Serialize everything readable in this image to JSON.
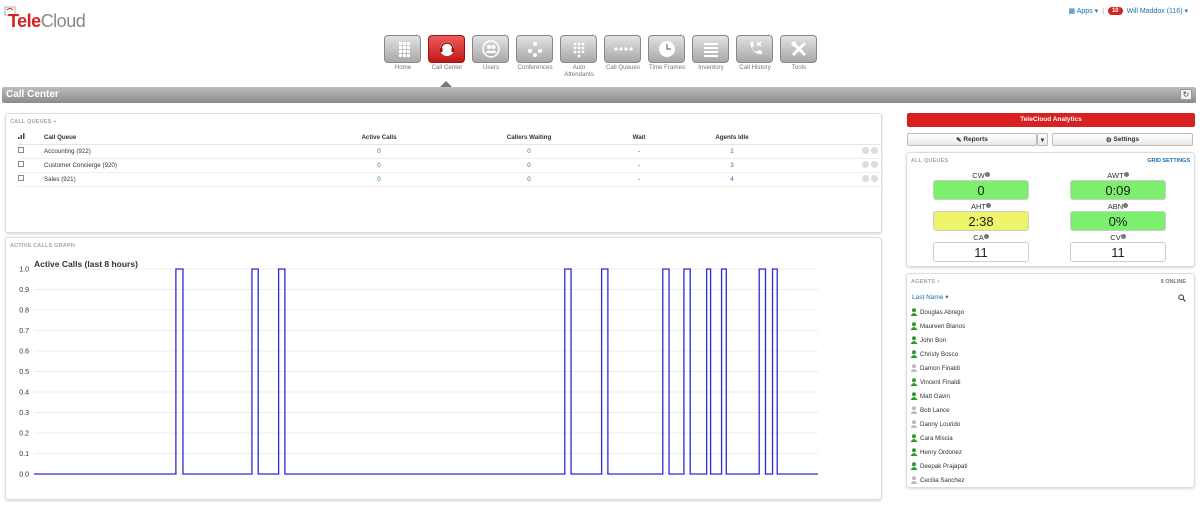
{
  "logo": "TeleCloud",
  "header": {
    "apps_label": "Apps",
    "badge": "10",
    "user_label": "Will Maddox (116)"
  },
  "nav": [
    {
      "label": "Home",
      "icon": "keypad-icon"
    },
    {
      "label": "Call Center",
      "icon": "headset-icon",
      "active": true
    },
    {
      "label": "Users",
      "icon": "users-icon"
    },
    {
      "label": "Conferences",
      "icon": "conference-icon"
    },
    {
      "label": "Auto Attendants",
      "icon": "dialpad-icon"
    },
    {
      "label": "Call Queues",
      "icon": "queue-icon"
    },
    {
      "label": "Time Frames",
      "icon": "clock-icon"
    },
    {
      "label": "Inventory",
      "icon": "list-icon"
    },
    {
      "label": "Call History",
      "icon": "phone-history-icon"
    },
    {
      "label": "Tools",
      "icon": "tools-icon"
    }
  ],
  "page_title": "Call Center",
  "queues": {
    "header": "CALL QUEUES »",
    "columns": [
      "Call Queue",
      "Active Calls",
      "Callers Waiting",
      "Wait",
      "Agents Idle"
    ],
    "rows": [
      {
        "name": "Accounting (922)",
        "active": "0",
        "waiting": "0",
        "wait": "-",
        "idle": "2"
      },
      {
        "name": "Customer Concierge (920)",
        "active": "0",
        "waiting": "0",
        "wait": "-",
        "idle": "3"
      },
      {
        "name": "Sales (921)",
        "active": "0",
        "waiting": "0",
        "wait": "-",
        "idle": "4"
      }
    ]
  },
  "graph": {
    "header": "ACTIVE CALLS GRAPH"
  },
  "chart_data": {
    "type": "line",
    "title": "Active Calls (last 8 hours)",
    "ylim": [
      0.0,
      1.0
    ],
    "yticks": [
      "0.0",
      "0.1",
      "0.2",
      "0.3",
      "0.4",
      "0.5",
      "0.6",
      "0.7",
      "0.8",
      "0.9",
      "1.0"
    ],
    "x_range": [
      0,
      1
    ],
    "pulses": [
      [
        0.181,
        0.19
      ],
      [
        0.278,
        0.286
      ],
      [
        0.312,
        0.32
      ],
      [
        0.677,
        0.685
      ],
      [
        0.724,
        0.732
      ],
      [
        0.802,
        0.81
      ],
      [
        0.829,
        0.837
      ],
      [
        0.858,
        0.863
      ],
      [
        0.877,
        0.883
      ],
      [
        0.925,
        0.933
      ],
      [
        0.942,
        0.948
      ]
    ],
    "grid": true,
    "color": "#2b2bd4"
  },
  "analytics": {
    "title": "TeleCloud Analytics",
    "reports_label": "Reports",
    "settings_label": "Settings"
  },
  "all_queues": {
    "header": "ALL QUEUES",
    "grid_settings": "GRID SETTINGS",
    "metrics": [
      {
        "label": "CW",
        "value": "0",
        "color": "#7cf06c"
      },
      {
        "label": "AWT",
        "value": "0:09",
        "color": "#7cf06c"
      },
      {
        "label": "AHT",
        "value": "2:38",
        "color": "#eef46a"
      },
      {
        "label": "ABN",
        "value": "0%",
        "color": "#7cf06c"
      },
      {
        "label": "CA",
        "value": "11",
        "color": "#ffffff"
      },
      {
        "label": "CV",
        "value": "11",
        "color": "#ffffff"
      }
    ]
  },
  "agents": {
    "header": "AGENTS »",
    "online": "9 ONLINE",
    "sort_label": "Last Name",
    "list": [
      {
        "name": "Douglas Abrego",
        "online": true
      },
      {
        "name": "Maureen Blanos",
        "online": true
      },
      {
        "name": "John Bon",
        "online": true
      },
      {
        "name": "Christy Bosco",
        "online": true
      },
      {
        "name": "Damon Finaldi",
        "online": false
      },
      {
        "name": "Vincent Finaldi",
        "online": true
      },
      {
        "name": "Matt Gavin",
        "online": true
      },
      {
        "name": "Bob Lance",
        "online": false
      },
      {
        "name": "Danny Lourido",
        "online": false
      },
      {
        "name": "Cara Miscia",
        "online": true
      },
      {
        "name": "Henry Ordonez",
        "online": true
      },
      {
        "name": "Deepak Prajapati",
        "online": true
      },
      {
        "name": "Cecilia Sanchez",
        "online": false
      }
    ]
  }
}
